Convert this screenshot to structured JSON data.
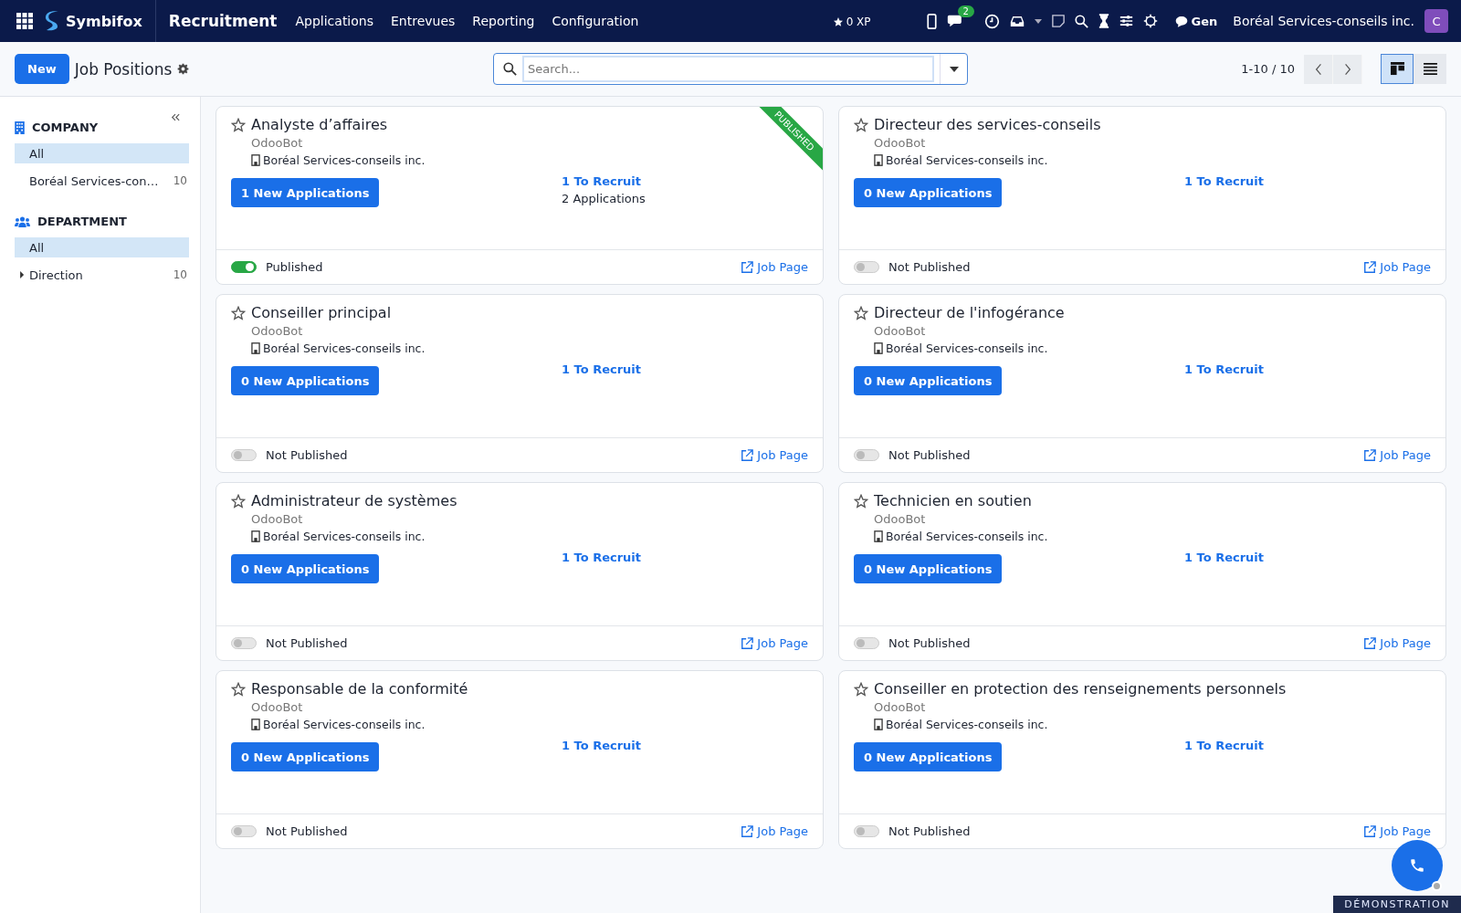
{
  "navbar": {
    "brand": "Symbifox",
    "app": "Recruitment",
    "menu": [
      "Applications",
      "Entrevues",
      "Reporting",
      "Configuration"
    ],
    "xp": "0 XP",
    "chat_count": "2",
    "chat_label": "Gen",
    "company": "Boréal Services-conseils inc.",
    "avatar": "C"
  },
  "control_panel": {
    "new_button": "New",
    "title": "Job Positions",
    "search": {
      "placeholder": "Search..."
    },
    "pager": "1-10 / 10",
    "views": [
      {
        "kind": "kanban",
        "selected": true
      },
      {
        "kind": "list",
        "selected": false
      }
    ]
  },
  "sidebar": {
    "sections": [
      {
        "kind": "company",
        "title": "COMPANY",
        "items": [
          {
            "label": "All",
            "selected": true
          },
          {
            "label": "Boréal Services-con…",
            "count": "10",
            "selected": false
          }
        ]
      },
      {
        "kind": "department",
        "title": "DEPARTMENT",
        "items": [
          {
            "label": "All",
            "selected": true
          },
          {
            "label": "Direction",
            "count": "10",
            "selected": false,
            "expanded": false
          }
        ]
      }
    ]
  },
  "cards": [
    {
      "title": "Analyste d’affaires",
      "favorite": false,
      "user": "OdooBot",
      "company": "Boréal Services-conseils inc.",
      "new_applications": "1 New Applications",
      "to_recruit": "1 To Recruit",
      "applications": "2 Applications",
      "published": true,
      "status": "Published",
      "ribbon": "PUBLISHED",
      "job_page": "Job Page"
    },
    {
      "title": "Directeur des services-conseils",
      "favorite": false,
      "user": "OdooBot",
      "company": "Boréal Services-conseils inc.",
      "new_applications": "0 New Applications",
      "to_recruit": "1 To Recruit",
      "published": false,
      "status": "Not Published",
      "job_page": "Job Page"
    },
    {
      "title": "Conseiller principal",
      "favorite": false,
      "user": "OdooBot",
      "company": "Boréal Services-conseils inc.",
      "new_applications": "0 New Applications",
      "to_recruit": "1 To Recruit",
      "published": false,
      "status": "Not Published",
      "job_page": "Job Page"
    },
    {
      "title": "Directeur de l'infogérance",
      "favorite": false,
      "user": "OdooBot",
      "company": "Boréal Services-conseils inc.",
      "new_applications": "0 New Applications",
      "to_recruit": "1 To Recruit",
      "published": false,
      "status": "Not Published",
      "job_page": "Job Page"
    },
    {
      "title": "Administrateur de systèmes",
      "favorite": false,
      "user": "OdooBot",
      "company": "Boréal Services-conseils inc.",
      "new_applications": "0 New Applications",
      "to_recruit": "1 To Recruit",
      "published": false,
      "status": "Not Published",
      "job_page": "Job Page"
    },
    {
      "title": "Technicien en soutien",
      "favorite": false,
      "user": "OdooBot",
      "company": "Boréal Services-conseils inc.",
      "new_applications": "0 New Applications",
      "to_recruit": "1 To Recruit",
      "published": false,
      "status": "Not Published",
      "job_page": "Job Page"
    },
    {
      "title": "Responsable de la conformité",
      "favorite": false,
      "user": "OdooBot",
      "company": "Boréal Services-conseils inc.",
      "new_applications": "0 New Applications",
      "to_recruit": "1 To Recruit",
      "published": false,
      "status": "Not Published",
      "job_page": "Job Page"
    },
    {
      "title": "Conseiller en protection des renseignements personnels",
      "favorite": false,
      "user": "OdooBot",
      "company": "Boréal Services-conseils inc.",
      "new_applications": "0 New Applications",
      "to_recruit": "1 To Recruit",
      "published": false,
      "status": "Not Published",
      "job_page": "Job Page"
    }
  ],
  "demo_banner": "DÉMONSTRATION"
}
